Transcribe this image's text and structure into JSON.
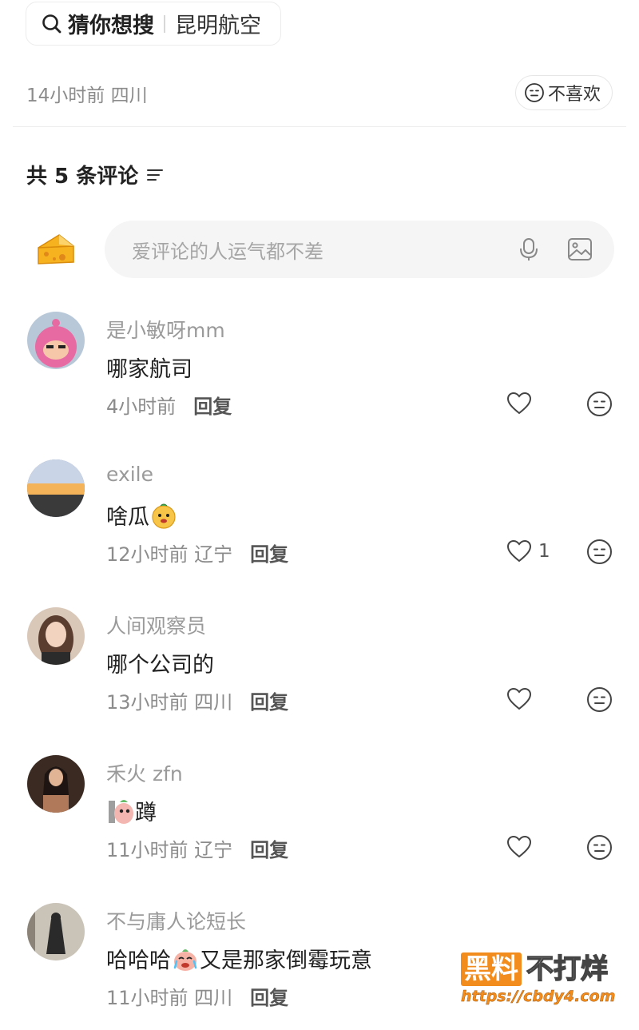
{
  "search": {
    "label": "猜你想搜",
    "term": "昆明航空"
  },
  "post": {
    "meta": "14小时前 四川",
    "dislike_label": "不喜欢"
  },
  "comments_header": {
    "title": "共 5 条评论"
  },
  "composer": {
    "placeholder": "爱评论的人运气都不差"
  },
  "comments": [
    {
      "username": "是小敏呀mm",
      "text": "哪家航司",
      "time": "4小时前",
      "reply": "回复",
      "likes": ""
    },
    {
      "username": "exile",
      "text": "啥瓜",
      "time": "12小时前 辽宁",
      "reply": "回复",
      "likes": "1"
    },
    {
      "username": "人间观察员",
      "text": "哪个公司的",
      "time": "13小时前 四川",
      "reply": "回复",
      "likes": ""
    },
    {
      "username": "禾火 zfn",
      "text": "蹲",
      "time": "11小时前 辽宁",
      "reply": "回复",
      "likes": ""
    },
    {
      "username": "不与庸人论短长",
      "text_before": "哈哈哈",
      "text_after": "又是那家倒霉玩意",
      "time": "11小时前 四川",
      "reply": "回复",
      "likes": ""
    }
  ],
  "watermark": {
    "box": "黑料",
    "text": "不打烊",
    "url": "https://cbdy4.com"
  },
  "colors": {
    "muted_text": "#8c8c8c",
    "composer_bg": "#f5f5f5",
    "watermark_orange": "#f28c1c"
  }
}
